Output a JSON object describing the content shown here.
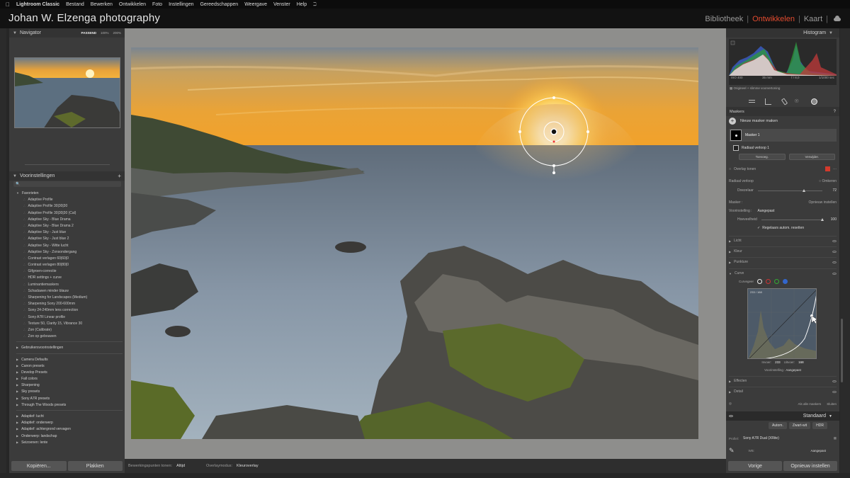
{
  "menubar": {
    "app": "Lightroom Classic",
    "items": [
      "Bestand",
      "Bewerken",
      "Ontwikkelen",
      "Foto",
      "Instellingen",
      "Gereedschappen",
      "Weergave",
      "Venster",
      "Help"
    ]
  },
  "identity": {
    "title": "Johan W. Elzenga photography"
  },
  "modules": {
    "library": "Bibliotheek",
    "develop": "Ontwikkelen",
    "map": "Kaart",
    "sep": "|"
  },
  "navigator": {
    "title": "Navigator",
    "zooms": [
      "PASSEND",
      "100%",
      "200%"
    ]
  },
  "presets": {
    "title": "Voorinstellingen",
    "groups": [
      {
        "name": "Favorieten",
        "expanded": true,
        "items": [
          "Adaptive Profile",
          "Adaptive Profile 30|30|30",
          "Adaptive Profile 30|30|30 (Cal)",
          "Adaptive Sky - Blue Drama",
          "Adaptive Sky - Blue Drama 2",
          "Adaptive Sky - Just blue",
          "Adaptive Sky - Just blue 2",
          "Adaptive Sky - Witte lucht",
          "Adaptive Sky - Zonsondergang",
          "Contrast verlagen 60|60|0",
          "Contrast verlagen 80|80|0",
          "Gifgroen-correctie",
          "HDR settings + curve",
          "Luminantiemaskers",
          "Schaduwen minder blauw",
          "Sharpening for Landscapes (Medium)",
          "Sharpening Sony 200-600mm",
          "Sony 24-240mm lens correction",
          "Sony A7R Linear profile",
          "Texture 50, Clarity 15, Vibrance 30",
          "Zon (Calibrate)",
          "Zon op gebouwen"
        ]
      },
      {
        "name": "Gebruikersvoorinstellingen",
        "expanded": false,
        "items": []
      },
      {
        "name": "Camera Defaults",
        "expanded": false,
        "items": []
      },
      {
        "name": "Canon presets",
        "expanded": false,
        "items": []
      },
      {
        "name": "Develop Presets",
        "expanded": false,
        "items": []
      },
      {
        "name": "Fall colors",
        "expanded": false,
        "items": []
      },
      {
        "name": "Sharpening",
        "expanded": false,
        "items": []
      },
      {
        "name": "Sky presets",
        "expanded": false,
        "items": []
      },
      {
        "name": "Sony A7R presets",
        "expanded": false,
        "items": []
      },
      {
        "name": "Through The Woods presets",
        "expanded": false,
        "items": []
      },
      {
        "name": "Adaptief: lucht",
        "expanded": false,
        "items": []
      },
      {
        "name": "Adaptief: onderwerp",
        "expanded": false,
        "items": []
      },
      {
        "name": "Adaptief: achtergrond vervagen",
        "expanded": false,
        "items": []
      },
      {
        "name": "Onderwerp: landschap",
        "expanded": false,
        "items": []
      },
      {
        "name": "Seizoenen: lente",
        "expanded": false,
        "items": []
      }
    ]
  },
  "left_buttons": {
    "copy": "Kopiëren...",
    "paste": "Plakken"
  },
  "toolbar": {
    "pins_label": "Bewerkingspunten tonen:",
    "pins_value": "Altijd",
    "overlay_label": "Overlaymodus:",
    "overlay_value": "Kleuroverlay"
  },
  "histogram": {
    "title": "Histogram",
    "iso": "ISO 400",
    "focal": "35 mm",
    "aperture": "f / 8,0",
    "shutter": "1/1000 sec",
    "original_label": "Origineel + slimme voorvertoning"
  },
  "masks": {
    "title": "Maskers",
    "new_mask": "Nieuw masker maken",
    "mask1": "Masker 1",
    "radial": "Radiaal verloop 1",
    "add": "Toevoeg.",
    "subtract": "Verwijder.",
    "overlay": "Overlay tonen",
    "overlay_color": "#d33a2c",
    "radial_section": "Radiaal verloop",
    "invert": "Omkeren",
    "feather_label": "Doezelaar",
    "feather_value": "72",
    "feather_fraction": 0.72,
    "mask_label": "Masker :",
    "reset_label": "Opnieuw instellen",
    "preset_label": "Voorinstelling :",
    "preset_value": "Aangepast",
    "amount_label": "Hoeveelheid",
    "amount_value": "100",
    "amount_fraction": 1.0,
    "auto_reset": "Regelaars autom. resetten",
    "sections": [
      "Licht",
      "Kleur",
      "Punkture"
    ],
    "curve_label": "Curve",
    "curve_mode": "Curvegeer",
    "curve_readout": "233 / 168",
    "input_label": "Invoer:",
    "input_value": "233",
    "output_label": "Uitvoer:",
    "output_value": "168",
    "curve_preset_label": "Voorinstelling :",
    "curve_preset_value": "Aangepast",
    "effects": "Effecten",
    "detail": "Detail",
    "show_all": "Als alle maskers",
    "close": "Sluiten"
  },
  "basic": {
    "title": "Standaard",
    "auto": "Autom.",
    "bw": "Zwart-wit",
    "hdr": "HDR",
    "profile_label": "Profiel:",
    "profile_value": "Sony A7R Dual (XRite)",
    "wb_label": "WB:",
    "wb_value": "Aangepast"
  },
  "right_buttons": {
    "previous": "Vorige",
    "reset": "Opnieuw instellen"
  }
}
